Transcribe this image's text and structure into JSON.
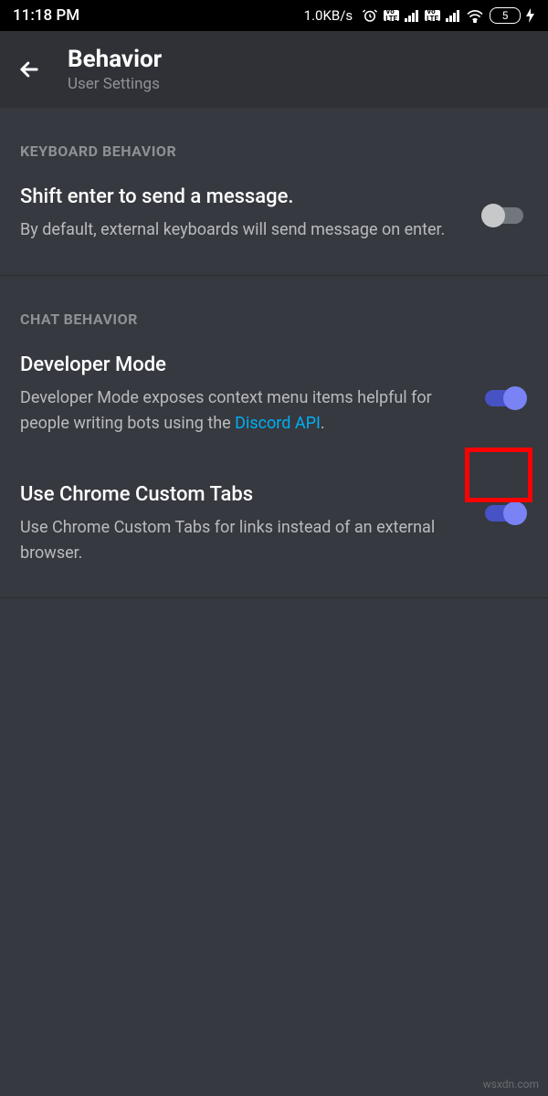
{
  "status_bar": {
    "time": "11:18 PM",
    "net_speed": "1.0KB/s",
    "battery": "5"
  },
  "header": {
    "title": "Behavior",
    "subtitle": "User Settings"
  },
  "sections": {
    "keyboard": {
      "label": "KEYBOARD BEHAVIOR",
      "item": {
        "title": "Shift enter to send a message.",
        "description": "By default, external keyboards will send message on enter.",
        "state": "off"
      }
    },
    "chat": {
      "label": "CHAT BEHAVIOR",
      "dev_mode": {
        "title": "Developer Mode",
        "desc_pre": "Developer Mode exposes context menu items helpful for people writing bots using the ",
        "link_text": "Discord API",
        "desc_post": ".",
        "state": "on"
      },
      "chrome_tabs": {
        "title": "Use Chrome Custom Tabs",
        "description": "Use Chrome Custom Tabs for links instead of an external browser.",
        "state": "on"
      }
    }
  },
  "watermark": "wsxdn.com"
}
